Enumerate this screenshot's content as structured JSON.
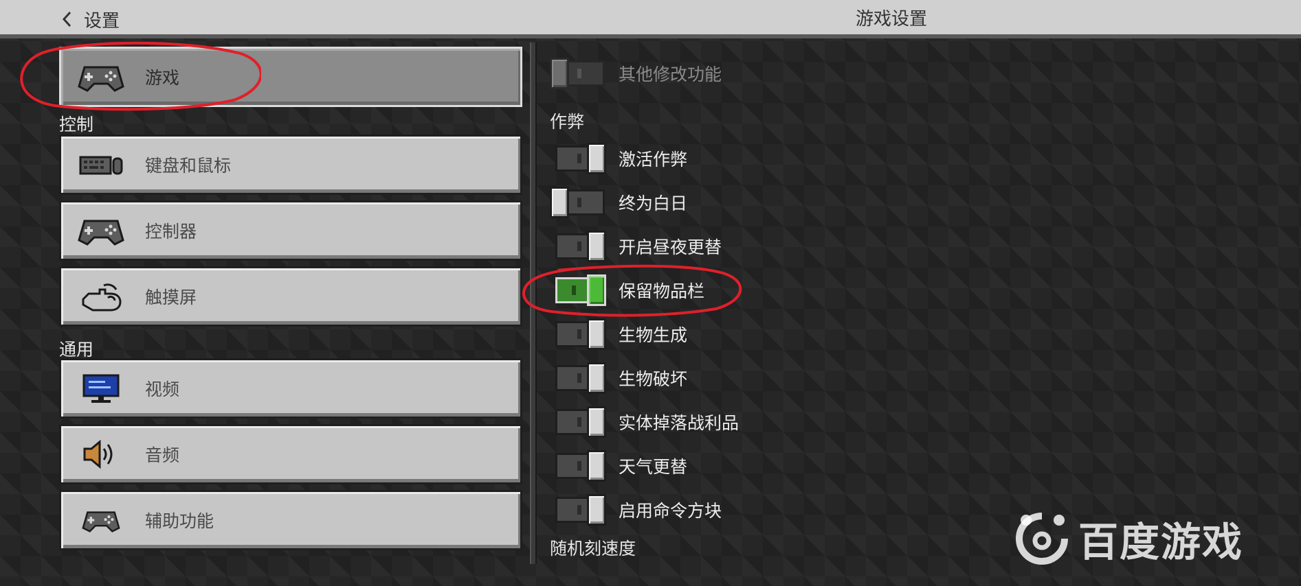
{
  "header": {
    "back_label": "设置",
    "title": "游戏设置"
  },
  "sidebar": {
    "top_item": {
      "label": "游戏",
      "icon": "controller-icon",
      "selected": true
    },
    "sections": [
      {
        "title": "控制",
        "items": [
          {
            "label": "键盘和鼠标",
            "icon": "keyboard-mouse-icon"
          },
          {
            "label": "控制器",
            "icon": "controller-icon"
          },
          {
            "label": "触摸屏",
            "icon": "touch-hand-icon"
          }
        ]
      },
      {
        "title": "通用",
        "items": [
          {
            "label": "视频",
            "icon": "monitor-icon"
          },
          {
            "label": "音频",
            "icon": "speaker-icon"
          },
          {
            "label": "辅助功能",
            "icon": "controller-icon"
          }
        ]
      }
    ]
  },
  "panel": {
    "other_modification": {
      "label": "其他修改功能",
      "state": "off",
      "enabled": false
    },
    "cheats_header": "作弊",
    "toggles": [
      {
        "label": "激活作弊",
        "state": "on"
      },
      {
        "label": "终为白日",
        "state": "off"
      },
      {
        "label": "开启昼夜更替",
        "state": "on"
      },
      {
        "label": "保留物品栏",
        "state": "on",
        "highlight": true
      },
      {
        "label": "生物生成",
        "state": "on"
      },
      {
        "label": "生物破坏",
        "state": "on"
      },
      {
        "label": "实体掉落战利品",
        "state": "on"
      },
      {
        "label": "天气更替",
        "state": "on"
      },
      {
        "label": "启用命令方块",
        "state": "on"
      }
    ],
    "tick_speed_header": "随机刻速度"
  },
  "watermark": {
    "text": "百度游戏"
  },
  "colors": {
    "toggle_active_green": "#4dba37",
    "annotation_red": "#e0202a"
  }
}
